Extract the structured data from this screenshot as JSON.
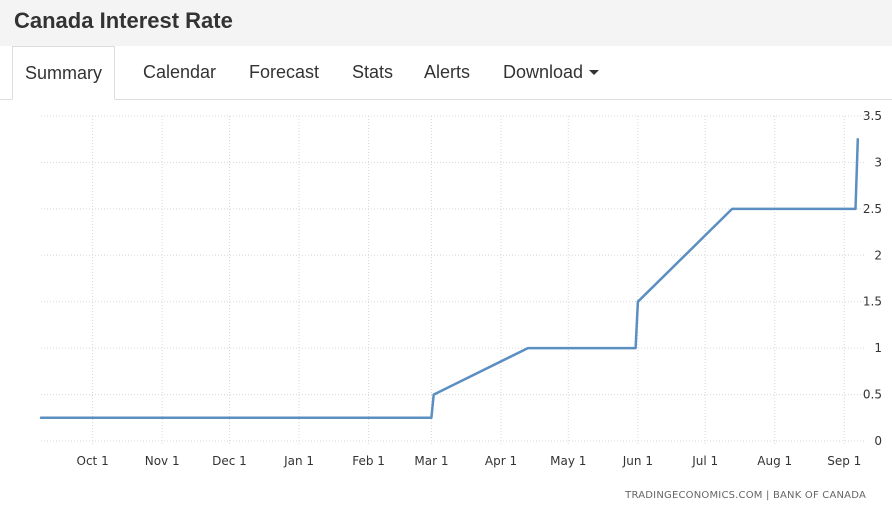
{
  "page": {
    "title": "Canada Interest Rate"
  },
  "tabs": [
    {
      "label": "Summary",
      "active": true
    },
    {
      "label": "Calendar"
    },
    {
      "label": "Forecast"
    },
    {
      "label": "Stats"
    },
    {
      "label": "Alerts"
    },
    {
      "label": "Download",
      "dropdown": true
    }
  ],
  "source": "TRADINGECONOMICS.COM | BANK OF CANADA",
  "chart_data": {
    "type": "line",
    "title": "",
    "xlabel": "",
    "ylabel": "",
    "x_tick_labels": [
      "Oct 1",
      "Nov 1",
      "Dec 1",
      "Jan 1",
      "Feb 1",
      "Mar 1",
      "Apr 1",
      "May 1",
      "Jun 1",
      "Jul 1",
      "Aug 1",
      "Sep 1"
    ],
    "x_tick_dates": [
      "2021-10-01",
      "2021-11-01",
      "2021-12-01",
      "2022-01-01",
      "2022-02-01",
      "2022-03-01",
      "2022-04-01",
      "2022-05-01",
      "2022-06-01",
      "2022-07-01",
      "2022-08-01",
      "2022-09-01"
    ],
    "xlim": [
      "2021-09-08",
      "2022-09-08"
    ],
    "yticks": [
      0,
      0.5,
      1,
      1.5,
      2,
      2.5,
      3,
      3.5
    ],
    "ylim": [
      0,
      3.5
    ],
    "y_axis_side": "right",
    "grid": true,
    "line_color": "#5b8fc1",
    "series": [
      {
        "points": [
          {
            "x": "2021-09-08",
            "y": 0.25
          },
          {
            "x": "2022-03-01",
            "y": 0.25
          },
          {
            "x": "2022-03-02",
            "y": 0.5
          },
          {
            "x": "2022-04-13",
            "y": 1.0
          },
          {
            "x": "2022-05-31",
            "y": 1.0
          },
          {
            "x": "2022-06-01",
            "y": 1.5
          },
          {
            "x": "2022-07-13",
            "y": 2.5
          },
          {
            "x": "2022-09-06",
            "y": 2.5
          },
          {
            "x": "2022-09-07",
            "y": 3.25
          }
        ]
      }
    ]
  }
}
